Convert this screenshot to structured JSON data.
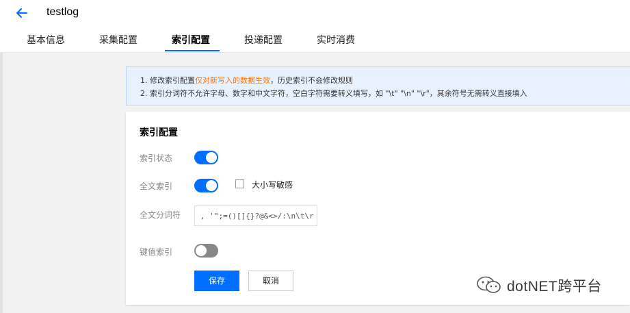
{
  "header": {
    "title": "testlog"
  },
  "tabs": [
    {
      "label": "基本信息"
    },
    {
      "label": "采集配置"
    },
    {
      "label": "索引配置",
      "active": true
    },
    {
      "label": "投递配置"
    },
    {
      "label": "实时消费"
    }
  ],
  "notice": {
    "line1_prefix": "1. 修改索引配置",
    "line1_highlight": "仅对新写入的数据生效",
    "line1_suffix": "，历史索引不会修改规则",
    "line2": "2. 索引分词符不允许字母、数字和中文字符，空白字符需要转义填写，如 \"\\t\" \"\\n\" \"\\r\"，其余符号无需转义直接填入"
  },
  "card": {
    "title": "索引配置",
    "index_status": {
      "label": "索引状态",
      "enabled": true
    },
    "fulltext_index": {
      "label": "全文索引",
      "enabled": true
    },
    "case_sensitive": {
      "label": "大小写敏感",
      "checked": false
    },
    "delimiter": {
      "label": "全文分词符",
      "value": ", '\";=()[]{}?@&<>/:\\n\\t\\r"
    },
    "kv_index": {
      "label": "键值索引",
      "enabled": false
    },
    "save_label": "保存",
    "cancel_label": "取消"
  },
  "watermark": {
    "text": "dotNET跨平台"
  },
  "colors": {
    "accent": "#006eff",
    "highlight": "#ff7200",
    "toggle_off": "#888888"
  }
}
